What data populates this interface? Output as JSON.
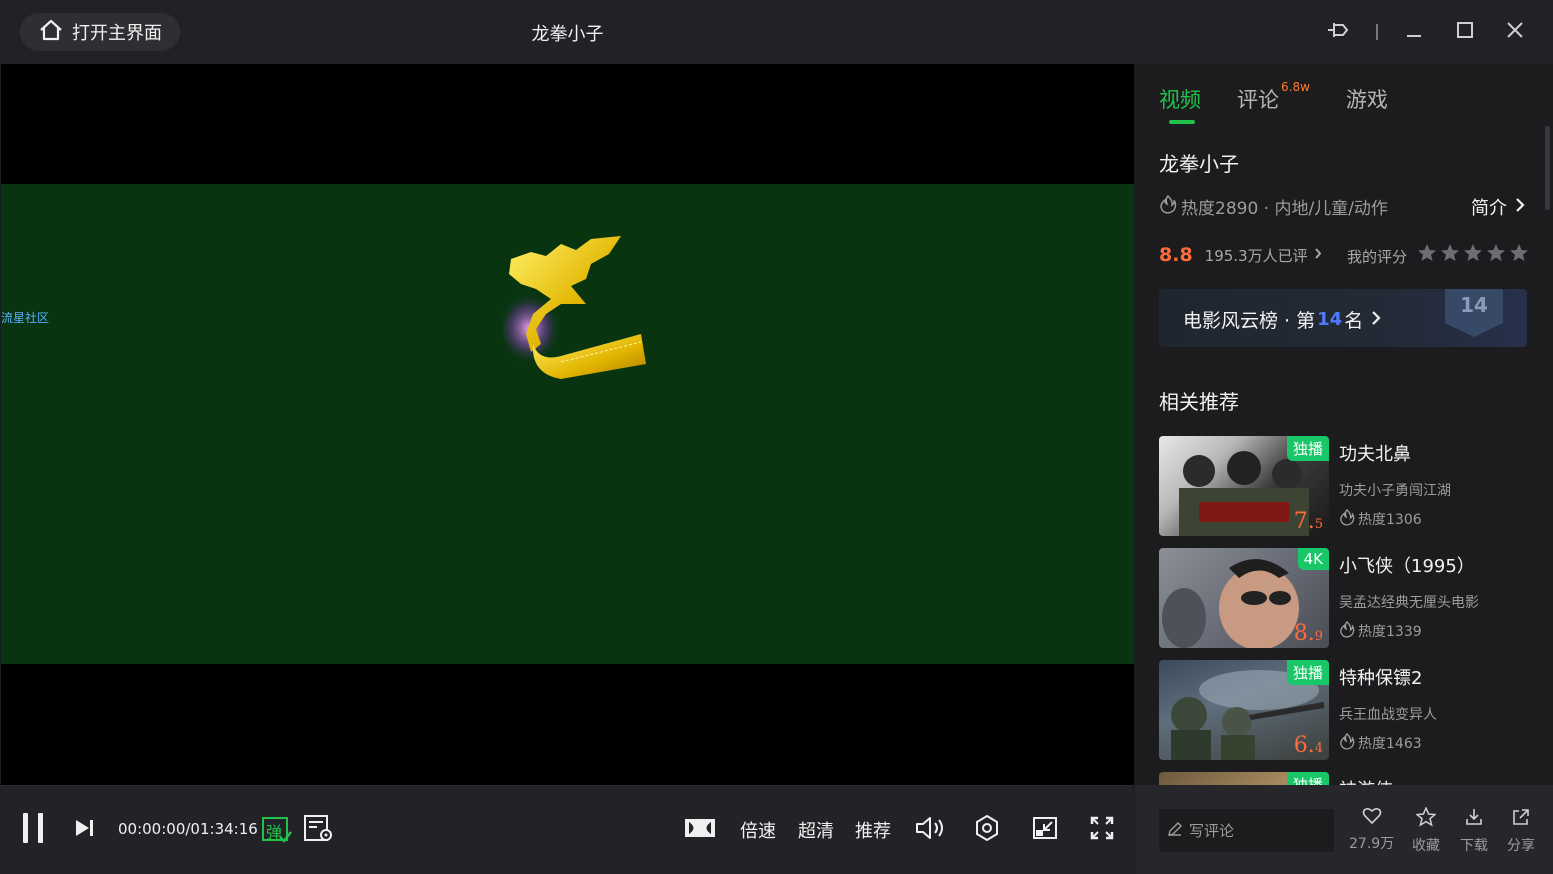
{
  "titlebar": {
    "home_label": "打开主界面",
    "title": "龙拳小子"
  },
  "video": {
    "watermark": "流星社区"
  },
  "controls": {
    "time": "00:00:00/01:34:16",
    "danmaku_glyph": "弹",
    "speed_label": "倍速",
    "quality_label": "超清",
    "recommend_label": "推荐"
  },
  "sidebar": {
    "tabs": [
      {
        "label": "视频",
        "active": true
      },
      {
        "label": "评论",
        "sup": "6.8w"
      },
      {
        "label": "游戏"
      }
    ],
    "movie_title": "龙拳小子",
    "meta": "热度2890 · 内地/儿童/动作",
    "intro_label": "简介",
    "score": "8.8",
    "rating_count": "195.3万人已评",
    "my_rating_label": "我的评分",
    "rank": {
      "prefix": "电影风云榜 · 第",
      "number": "14",
      "suffix": "名",
      "badge_number": "14"
    },
    "related_title": "相关推荐",
    "recommendations": [
      {
        "title": "功夫北鼻",
        "badge": "独播",
        "score_int": "7.",
        "score_dec": "5",
        "subtitle": "功夫小子勇闯江湖",
        "hot": "热度1306"
      },
      {
        "title": "小飞侠（1995）",
        "badge": "4K",
        "score_int": "8.",
        "score_dec": "9",
        "subtitle": "吴孟达经典无厘头电影",
        "hot": "热度1339"
      },
      {
        "title": "特种保镖2",
        "badge": "独播",
        "score_int": "6.",
        "score_dec": "4",
        "subtitle": "兵王血战变异人",
        "hot": "热度1463"
      },
      {
        "title": "神游侠",
        "badge": "独播",
        "score_int": "",
        "score_dec": "",
        "subtitle": "",
        "hot": ""
      }
    ]
  },
  "bottom": {
    "comment_placeholder": "写评论",
    "like_count": "27.9万",
    "favorite_label": "收藏",
    "download_label": "下载",
    "share_label": "分享"
  },
  "colors": {
    "accent_green": "#21c24a",
    "score_orange": "#ff6a3c",
    "rank_blue": "#4f7cff",
    "badge_green": "#18c767",
    "frame_green": "#083510"
  }
}
